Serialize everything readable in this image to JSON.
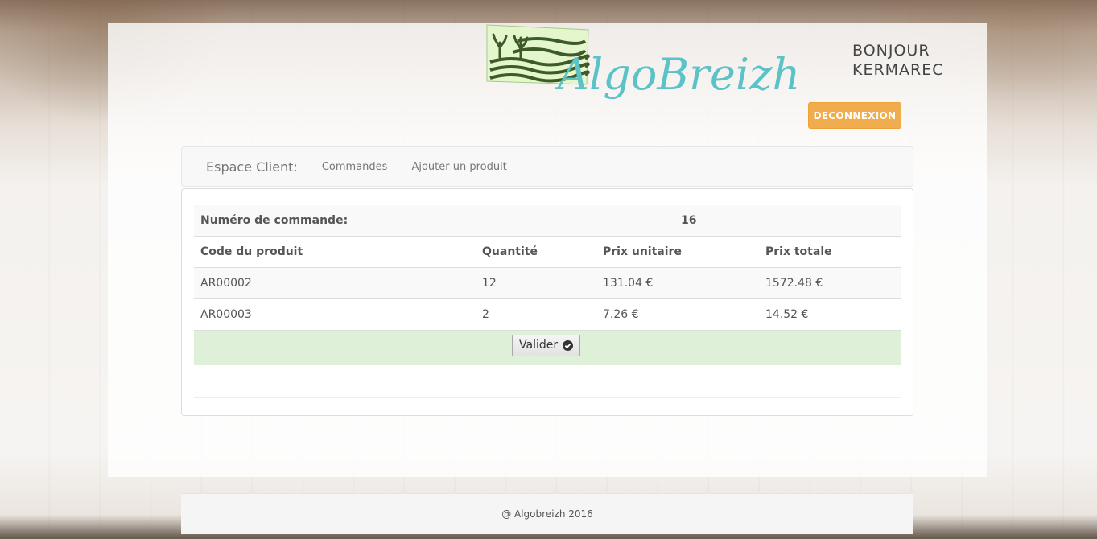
{
  "brand": {
    "logo_text": "AlgoBreizh",
    "colors": {
      "logo_teal": "#5bc2c7",
      "flag_green": "#e4f7cc",
      "flag_dark": "#3d5a28"
    }
  },
  "header": {
    "greeting_line1": "BONJOUR",
    "greeting_line2": "KERMAREC",
    "logout_label": "DECONNEXION",
    "logout_color": "#f0ad4e"
  },
  "nav": {
    "brand": "Espace Client:",
    "links": [
      {
        "label": "Commandes"
      },
      {
        "label": "Ajouter un produit"
      }
    ]
  },
  "order": {
    "number_label": "Numéro de commande:",
    "number_value": "16",
    "columns": [
      "Code du produit",
      "Quantité",
      "Prix unitaire",
      "Prix totale"
    ],
    "rows": [
      [
        "AR00002",
        "12",
        "131.04 €",
        "1572.48 €"
      ],
      [
        "AR00003",
        "2",
        "7.26 €",
        "14.52 €"
      ]
    ],
    "validate_label": "Valider",
    "success_color": "#dff0d8"
  },
  "footer": {
    "text": "@ Algobreizh 2016"
  }
}
